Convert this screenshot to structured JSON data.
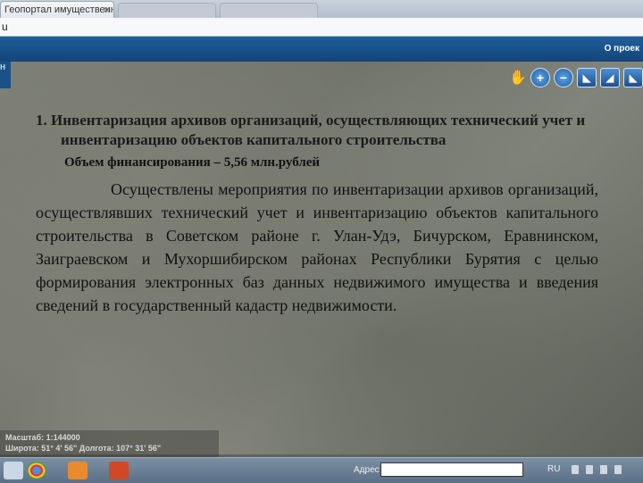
{
  "browser": {
    "tab_title": "Геопортал имущественн",
    "tab_close": "×",
    "address_fragment": "u"
  },
  "portal": {
    "left_label": "н",
    "about_label": "О проек"
  },
  "toolbar": {
    "hand_icon": "✋",
    "zoom_in_icon": "+",
    "zoom_out_icon": "−",
    "measure_line_icon": "◣",
    "measure_area_icon": "◢",
    "extra_icon": "◣"
  },
  "slide": {
    "heading": "1. Инвентаризация архивов организаций, осуществляющих технический учет и инвентаризацию  объектов капитального строительства",
    "funding": "Объем финансирования – 5,56 млн.рублей",
    "body": "Осуществлены мероприятия по инвентаризации архивов организаций, осуществлявших технический учет и инвентаризацию объектов капитального строительства в Советском районе г. Улан-Удэ, Бичурском, Еравнинском, Заиграевском и Мухоршибирском районах Республики Бурятия с целью формирования электронных баз данных недвижимого имущества и введения сведений в государственный кадастр недвижимости."
  },
  "status": {
    "scale": "Масштаб: 1:144000",
    "coords": "Широта: 51° 4' 56\" Долгота: 107° 31' 56\""
  },
  "taskbar": {
    "address_label": "Адрес",
    "lang": "RU"
  },
  "colors": {
    "header_blue": "#1f5f9c",
    "taskbar": "#6b7f96"
  }
}
